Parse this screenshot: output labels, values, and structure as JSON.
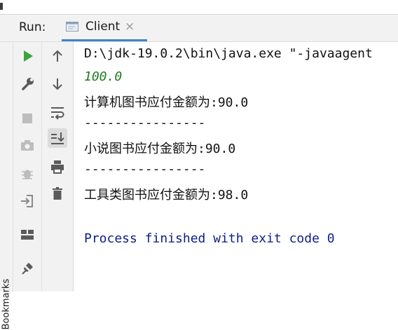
{
  "header": {
    "run_label": "Run:",
    "tab_title": "Client",
    "tab_close": "×"
  },
  "left_panel": {
    "bookmarks_label": "Bookmarks"
  },
  "console": {
    "lines": [
      "D:\\jdk-19.0.2\\bin\\java.exe \"-javaagent",
      "100.0",
      "计算机图书应付金额为:90.0",
      "----------------",
      "小说图书应付金额为:90.0",
      "----------------",
      "工具类图书应付金额为:98.0",
      "",
      "Process finished with exit code 0"
    ]
  },
  "colors": {
    "accent": "#4083c9",
    "run_green": "#3aa53a",
    "output_green": "#1f7a1f",
    "process_blue": "#0b1e86"
  },
  "icons": [
    "rerun-icon",
    "wrench-icon",
    "stop-icon",
    "camera-icon",
    "bug-icon",
    "login-icon",
    "layout-icon",
    "pin-icon",
    "arrow-up-icon",
    "arrow-down-icon",
    "soft-wrap-icon",
    "scroll-to-end-icon",
    "print-icon",
    "trash-icon",
    "console-tab-icon"
  ]
}
